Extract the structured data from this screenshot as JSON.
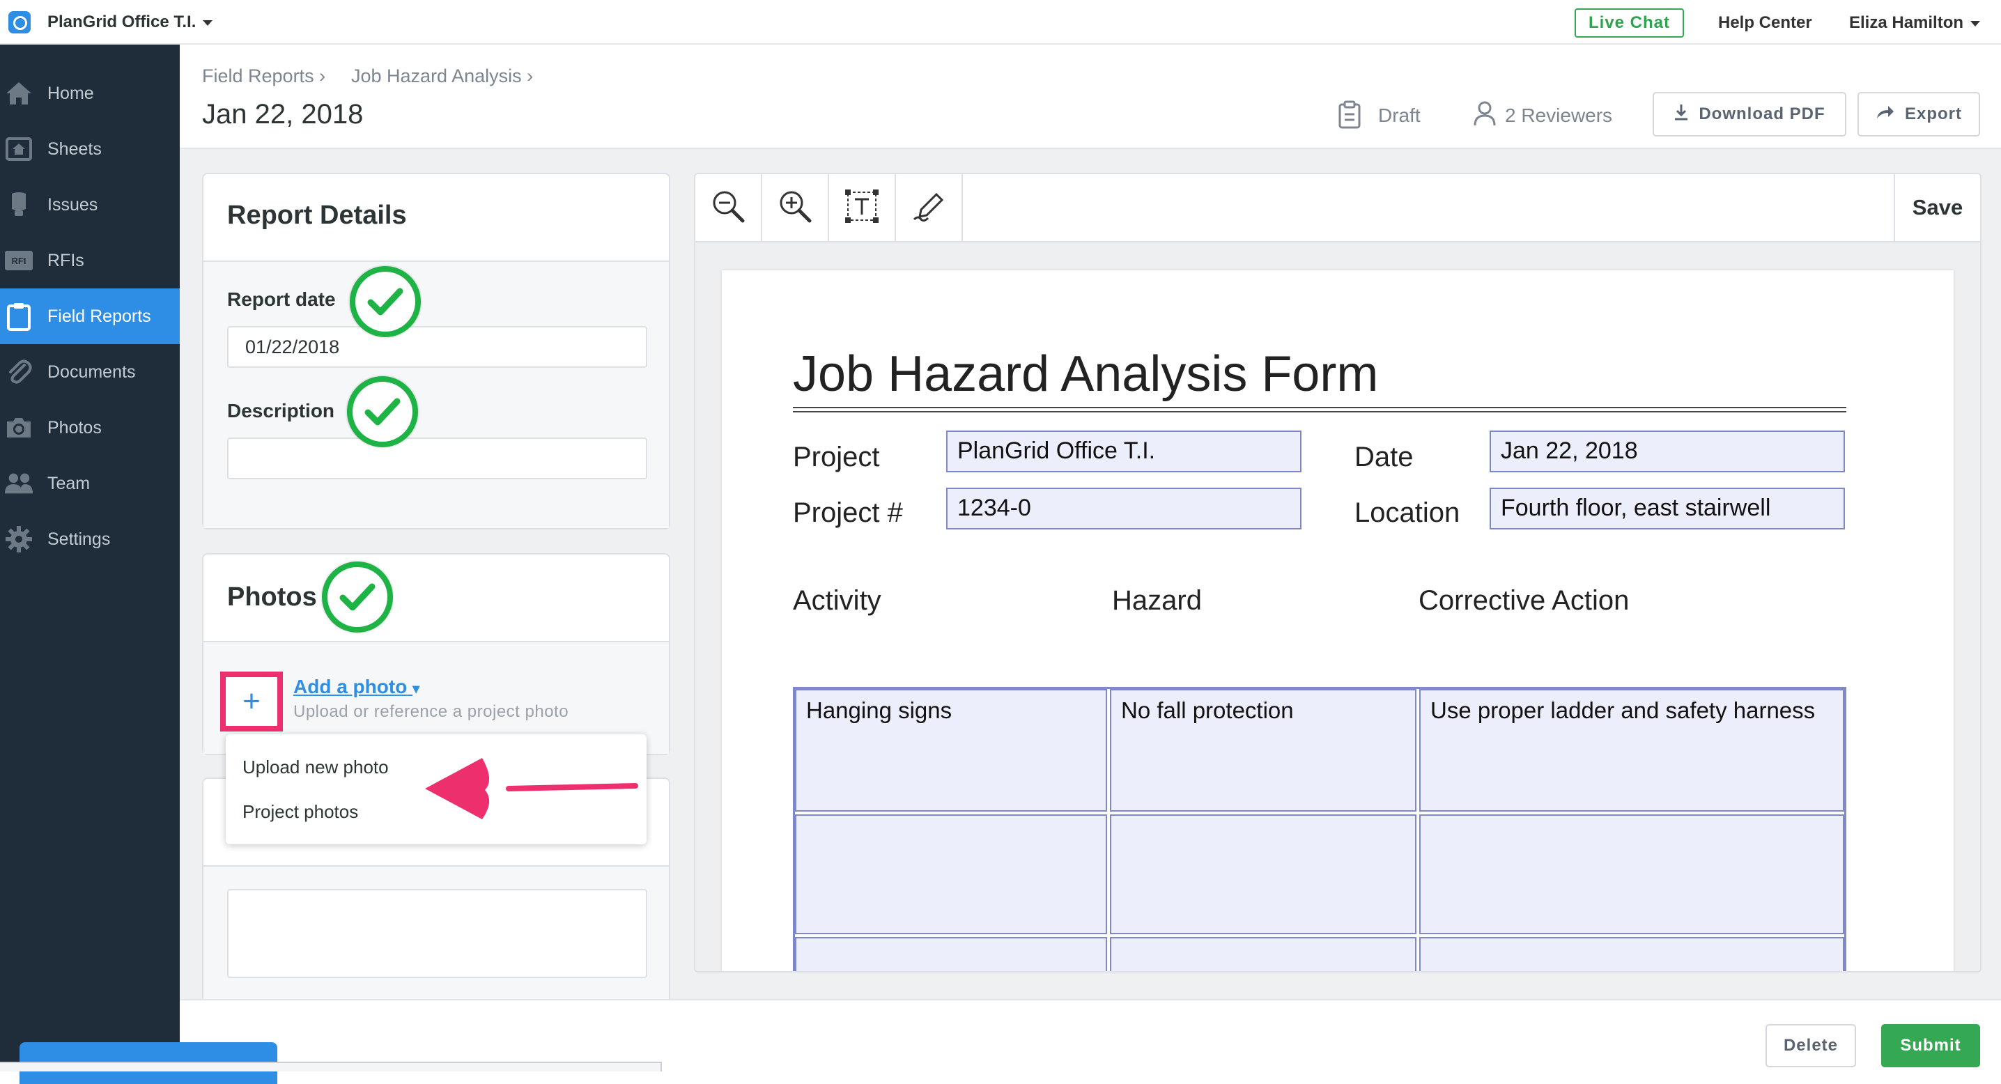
{
  "topbar": {
    "project_name": "PlanGrid Office T.I.",
    "live_chat": "Live Chat",
    "help_center": "Help Center",
    "user_name": "Eliza Hamilton"
  },
  "sidebar": {
    "items": [
      {
        "label": "Home",
        "icon": "home-icon"
      },
      {
        "label": "Sheets",
        "icon": "sheets-icon"
      },
      {
        "label": "Issues",
        "icon": "issues-icon"
      },
      {
        "label": "RFIs",
        "icon": "rfi-icon"
      },
      {
        "label": "Field Reports",
        "icon": "clipboard-icon",
        "active": true
      },
      {
        "label": "Documents",
        "icon": "paperclip-icon"
      },
      {
        "label": "Photos",
        "icon": "camera-icon"
      },
      {
        "label": "Team",
        "icon": "team-icon"
      },
      {
        "label": "Settings",
        "icon": "gear-icon"
      }
    ]
  },
  "header": {
    "breadcrumb": [
      "Field Reports",
      "Job Hazard Analysis"
    ],
    "separator": "›",
    "title": "Jan 22, 2018",
    "status": "Draft",
    "reviewers": "2 Reviewers",
    "download_pdf": "Download PDF",
    "export": "Export"
  },
  "report_details": {
    "title": "Report Details",
    "report_date_label": "Report date",
    "report_date_value": "01/22/2018",
    "description_label": "Description",
    "description_value": ""
  },
  "photos": {
    "title": "Photos",
    "plus": "+",
    "add_photo": "Add a photo",
    "add_photo_sub": "Upload or reference a project photo",
    "menu": [
      "Upload new photo",
      "Project photos"
    ]
  },
  "viewer": {
    "save": "Save",
    "tools": [
      "zoom-out-icon",
      "zoom-in-icon",
      "text-box-icon",
      "signature-pen-icon"
    ]
  },
  "form": {
    "title": "Job Hazard Analysis Form",
    "project_label": "Project",
    "project_value": "PlanGrid Office T.I.",
    "project_num_label": "Project #",
    "project_num_value": "1234-0",
    "date_label": "Date",
    "date_value": "Jan 22, 2018",
    "location_label": "Location",
    "location_value": "Fourth floor, east stairwell",
    "columns": [
      "Activity",
      "Hazard",
      "Corrective Action"
    ],
    "rows": [
      [
        "Hanging signs",
        "No fall protection",
        "Use proper ladder and safety harness"
      ],
      [
        "",
        "",
        ""
      ],
      [
        "",
        "",
        ""
      ]
    ]
  },
  "footer": {
    "delete": "Delete",
    "submit": "Submit"
  },
  "colors": {
    "accent": "#2e8ee5",
    "sidebar_bg": "#1f2d3a",
    "success": "#34a853",
    "highlight": "#ee2f6e",
    "check_green": "#1db445"
  }
}
